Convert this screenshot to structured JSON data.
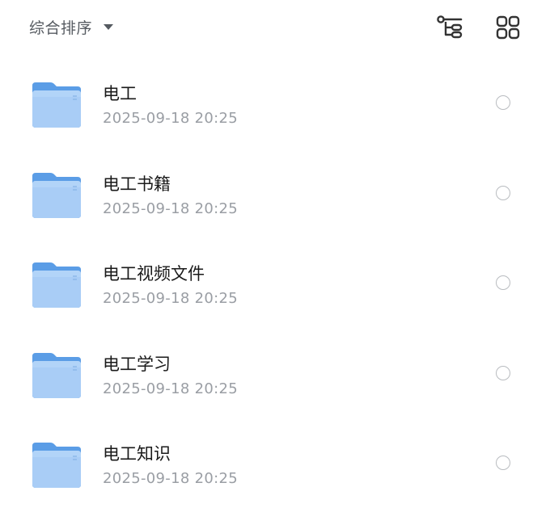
{
  "sort": {
    "label": "综合排序"
  },
  "toolbar": {
    "tree_icon": "tree-view-icon",
    "grid_icon": "grid-view-icon"
  },
  "colors": {
    "folder_back": "#5b9de6",
    "folder_front": "#a9cdf6",
    "text_primary": "#1a1a1a",
    "text_secondary": "#9a9ea4"
  },
  "files": [
    {
      "name": "电工",
      "date": "2025-09-18 20:25",
      "icon": "folder-icon"
    },
    {
      "name": "电工书籍",
      "date": "2025-09-18 20:25",
      "icon": "folder-icon"
    },
    {
      "name": "电工视频文件",
      "date": "2025-09-18 20:25",
      "icon": "folder-icon"
    },
    {
      "name": "电工学习",
      "date": "2025-09-18 20:25",
      "icon": "folder-icon"
    },
    {
      "name": "电工知识",
      "date": "2025-09-18 20:25",
      "icon": "folder-icon"
    }
  ]
}
